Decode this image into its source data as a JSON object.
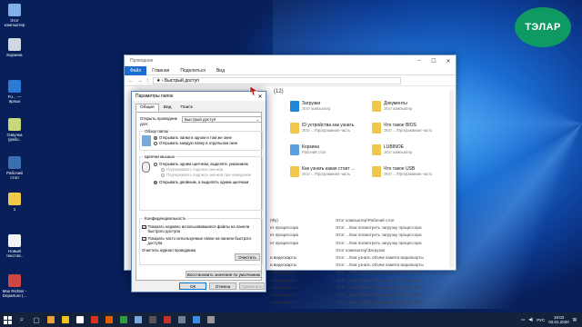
{
  "logo_text": "ТЭЛАР",
  "desktop_icons": [
    {
      "label": "Этот компьютер",
      "color": "#7fb0e8"
    },
    {
      "label": "Корзина",
      "color": "#cfd8e2"
    },
    {
      "label": "Fo... — ярлык",
      "color": "#2a7ad4"
    },
    {
      "label": "Озвучка (рабо..",
      "color": "#c7d87a"
    },
    {
      "label": "Рабочий стол",
      "color": "#3a6fb0"
    },
    {
      "label": "1",
      "color": "#f2c84b"
    },
    {
      "label": "Новый текстов..",
      "color": "#f4f4f4"
    },
    {
      "label": "Max Richter - Departure (...",
      "color": "#d24545"
    }
  ],
  "explorer": {
    "title": "Проводник",
    "ribbon_tabs": [
      "Файл",
      "Главная",
      "Поделиться",
      "Вид"
    ],
    "address": "Быстрый доступ",
    "folder_count": "(12)",
    "items": [
      {
        "name": "Загрузки",
        "sub": "Этот компьютер",
        "color": "#1e88d6"
      },
      {
        "name": "Документы",
        "sub": "Этот компьютер",
        "color": "#f2c84b"
      },
      {
        "name": "ID устройства как узнать",
        "sub": "Этот ...\\Программная часть",
        "color": "#f2c84b"
      },
      {
        "name": "Что такое BIOS",
        "sub": "Этот ...\\Программная часть",
        "color": "#f2c84b"
      },
      {
        "name": "Корзина",
        "sub": "Рабочий стол",
        "color": "#5aa0e0"
      },
      {
        "name": "LUBINOE",
        "sub": "Этот компьютер",
        "color": "#f2c84b"
      },
      {
        "name": "Как узнать какая стоит ...",
        "sub": "Этот ...\\Программная часть",
        "color": "#f2c84b"
      },
      {
        "name": "Что такое USB",
        "sub": "Этот ...\\Программная часть",
        "color": "#f2c84b"
      }
    ],
    "recent": [
      {
        "a": "(Фу)",
        "b": "Этот компьютер\\Рабочий стол"
      },
      {
        "a": "нт процессора",
        "b": "Этот ...\\Как посмотреть загрузку процессора"
      },
      {
        "a": "нт процессора",
        "b": "Этот ...\\Как посмотреть загрузку процессора"
      },
      {
        "a": "нт процессора",
        "b": "Этот ...\\Как посмотреть загрузку процессора"
      },
      {
        "a": "",
        "b": "Этот компьютер\\Загрузки"
      },
      {
        "a": "и видеокарты",
        "b": "Этот ...\\Как узнать объём памяти видеокарты"
      },
      {
        "a": "и видеокарты",
        "b": "Этот ...\\Как узнать объём памяти видеокарты"
      },
      {
        "a": "и видеокарты",
        "b": "Этот ...\\Как узнать объём памяти видеокарты"
      },
      {
        "a": "и видеокарты",
        "b": "Этот ...\\Как узнать объём памяти видеокарты"
      },
      {
        "a": "и видеокарты",
        "b": "Этот ...\\Как узнать объём памяти видеокарты"
      },
      {
        "a": "и видеокарты",
        "b": "Этот ...\\Как узнать объём памяти видеокарты"
      },
      {
        "a": "и видеокарты",
        "b": "Этот ...\\Как узнать объём памяти видеокарты"
      }
    ]
  },
  "dialog": {
    "title": "Параметры папок",
    "tabs": [
      "Общие",
      "Вид",
      "Поиск"
    ],
    "open_explorer_label": "Открыть проводник для:",
    "open_explorer_value": "Быстрый доступ",
    "browse_legend": "Обзор папок",
    "browse_options": [
      "Открывать папки в одном и том же окне",
      "Открывать каждую папку в отдельном окне"
    ],
    "click_legend": "Щелчки мышью",
    "click_single": "Открывать одним щелчком, выделять указанием",
    "click_sub1": "Подчеркивать подписи значков",
    "click_sub2": "Подчеркивать подписи значков при наведении",
    "click_double": "Открывать двойным, а выделять одним щелчком",
    "privacy_legend": "Конфиденциальность",
    "privacy_check1": "Показать недавно использовавшиеся файлы на панели быстрого доступа",
    "privacy_check2": "Показать часто используемые папки на панели быстрого доступа",
    "clear_history_label": "Очистить журнал проводника",
    "clear_button": "Очистить",
    "restore_button": "Восстановить значения по умолчанию",
    "ok": "ОК",
    "cancel": "Отмена",
    "apply": "Применить"
  },
  "taskbar": {
    "language": "РУС",
    "time": "19:03",
    "date": "02.01.2020"
  }
}
